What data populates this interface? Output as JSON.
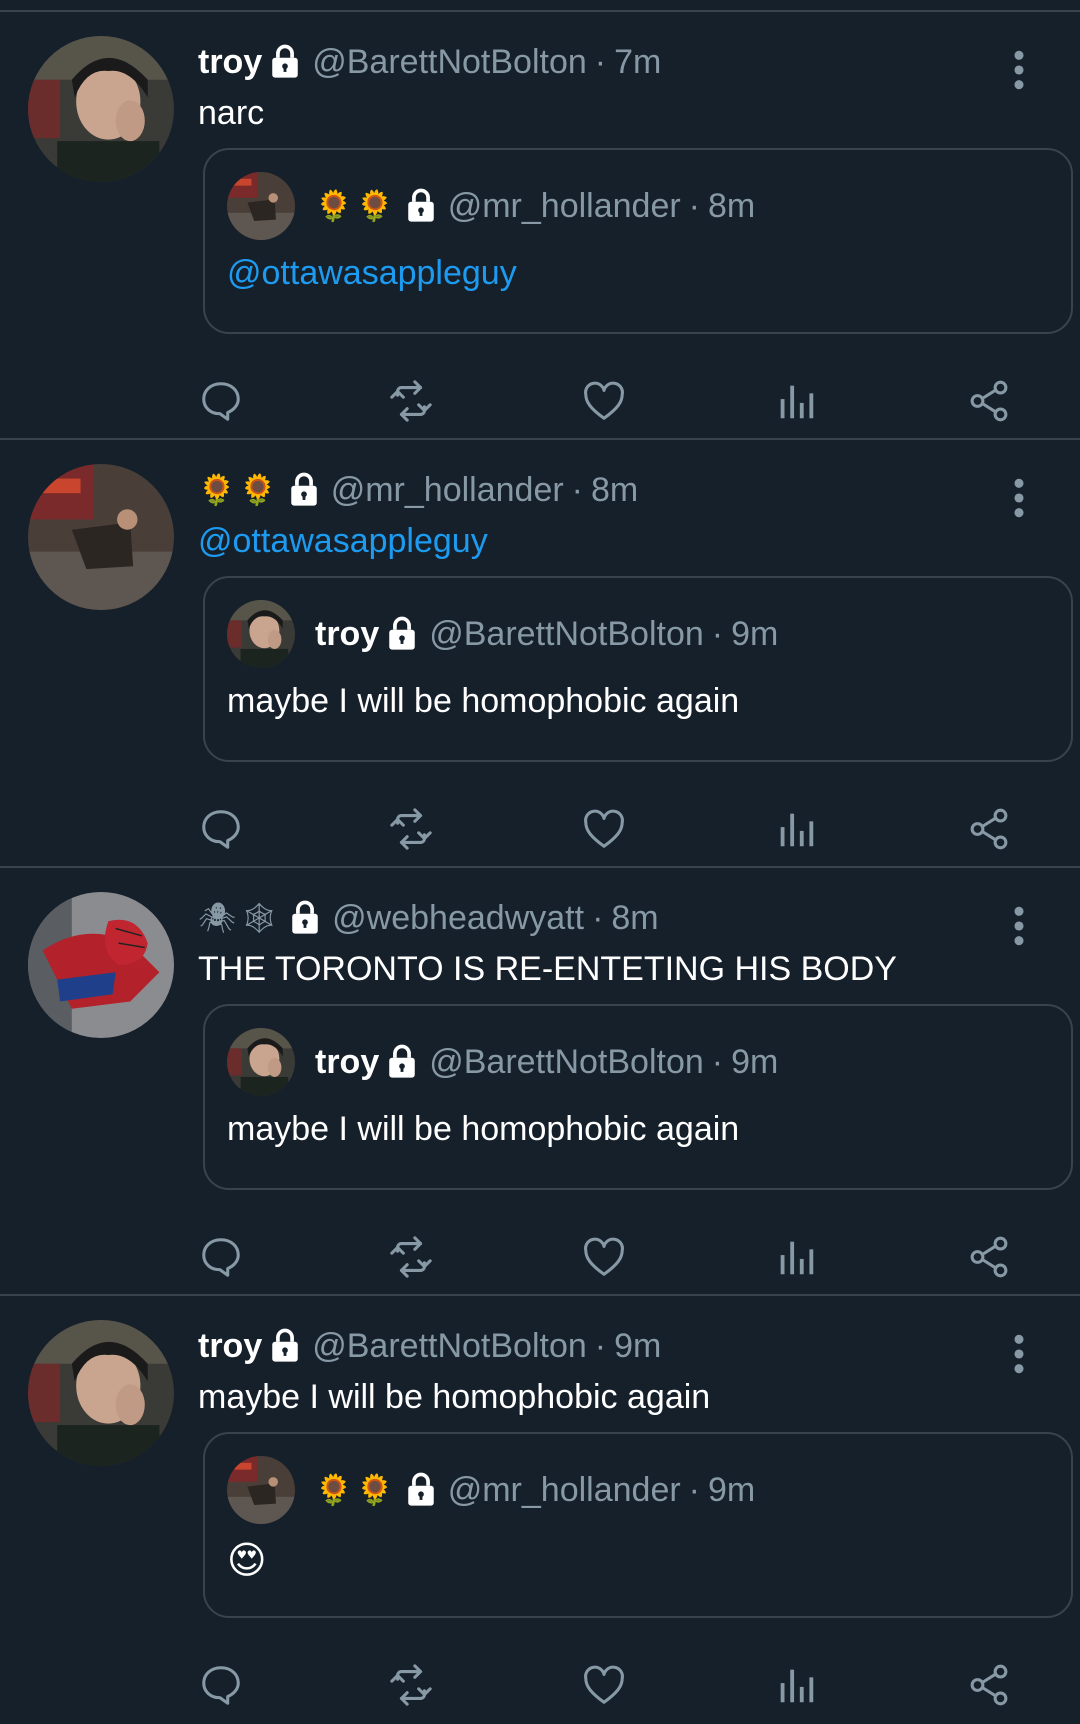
{
  "colors": {
    "background": "#15202b",
    "divider": "#38444d",
    "text": "#ffffff",
    "muted": "#8899a6",
    "link": "#1d9bf0"
  },
  "tweets": [
    {
      "name": "troy",
      "handle": "@BarettNotBolton",
      "dot": "·",
      "time": "7m",
      "text": "narc",
      "text_is_link": false,
      "avatar": "troy-avatar",
      "quote": {
        "name_emoji": "🌻🌻",
        "handle": "@mr_hollander",
        "dot": "·",
        "time": "8m",
        "text": "@ottawasappleguy",
        "text_is_link": true,
        "avatar": "hollander-avatar"
      }
    },
    {
      "name_emoji": "🌻🌻",
      "handle": "@mr_hollander",
      "dot": "·",
      "time": "8m",
      "text": "@ottawasappleguy",
      "text_is_link": true,
      "avatar": "hollander-avatar",
      "quote": {
        "name": "troy",
        "handle": "@BarettNotBolton",
        "dot": "·",
        "time": "9m",
        "text": "maybe I will be homophobic again",
        "text_is_link": false,
        "avatar": "troy-avatar"
      }
    },
    {
      "name_emoji": "🕷🕸",
      "handle": "@webheadwyatt",
      "dot": "·",
      "time": "8m",
      "text": "THE TORONTO IS RE-ENTETING HIS BODY",
      "text_is_link": false,
      "avatar": "spiderman-avatar",
      "quote": {
        "name": "troy",
        "handle": "@BarettNotBolton",
        "dot": "·",
        "time": "9m",
        "text": "maybe I will be homophobic again",
        "text_is_link": false,
        "avatar": "troy-avatar"
      }
    },
    {
      "name": "troy",
      "handle": "@BarettNotBolton",
      "dot": "·",
      "time": "9m",
      "text": "maybe I will be homophobic again",
      "text_is_link": false,
      "avatar": "troy-avatar",
      "quote": {
        "name_emoji": "🌻🌻",
        "handle": "@mr_hollander",
        "dot": "·",
        "time": "9m",
        "text": "😍",
        "text_is_link": false,
        "avatar": "hollander-avatar"
      }
    }
  ],
  "icons": {
    "lock": "lock-icon",
    "more": "more-vertical-icon",
    "reply": "reply-icon",
    "retweet": "retweet-icon",
    "like": "heart-icon",
    "analytics": "analytics-icon",
    "share": "share-icon"
  }
}
